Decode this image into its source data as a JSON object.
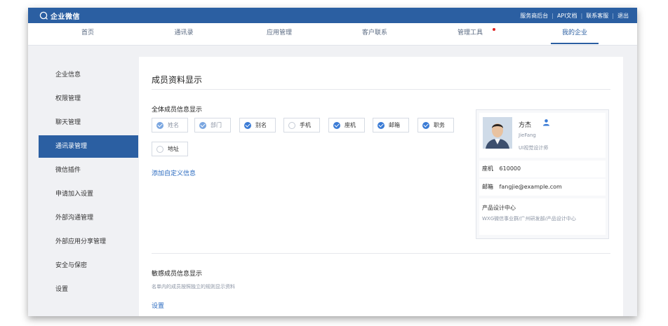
{
  "topbar": {
    "logo_text": "企业微信",
    "links": [
      "服务商后台",
      "API文档",
      "联系客服",
      "退出"
    ]
  },
  "nav": {
    "tabs": [
      {
        "label": "首页"
      },
      {
        "label": "通讯录"
      },
      {
        "label": "应用管理"
      },
      {
        "label": "客户联系"
      },
      {
        "label": "管理工具"
      },
      {
        "label": "我的企业"
      }
    ],
    "active": "我的企业",
    "badge_on": "管理工具"
  },
  "sidebar": {
    "items": [
      {
        "label": "企业信息"
      },
      {
        "label": "权限管理"
      },
      {
        "label": "聊天管理"
      },
      {
        "label": "通讯录管理"
      },
      {
        "label": "微信插件"
      },
      {
        "label": "申请加入设置"
      },
      {
        "label": "外部沟通管理"
      },
      {
        "label": "外部应用分享管理"
      },
      {
        "label": "安全与保密"
      },
      {
        "label": "设置"
      }
    ],
    "active": "通讯录管理"
  },
  "main": {
    "title": "成员资料显示",
    "all_members_label": "全体成员信息显示",
    "fields": [
      {
        "label": "姓名",
        "checked": true,
        "locked": true
      },
      {
        "label": "部门",
        "checked": true,
        "locked": true
      },
      {
        "label": "别名",
        "checked": true,
        "locked": false
      },
      {
        "label": "手机",
        "checked": false,
        "locked": false
      },
      {
        "label": "座机",
        "checked": true,
        "locked": false
      },
      {
        "label": "邮箱",
        "checked": true,
        "locked": false
      },
      {
        "label": "职务",
        "checked": true,
        "locked": false
      },
      {
        "label": "地址",
        "checked": false,
        "locked": false
      }
    ],
    "add_custom_link": "添加自定义信息",
    "sensitive_label": "敏感成员信息显示",
    "sensitive_desc": "名单内的成员按照独立的规则显示资料",
    "settings_link": "设置"
  },
  "preview_card": {
    "name": "方杰",
    "english_name": "JieFang",
    "role": "UI视觉设计师",
    "phone_key": "座机",
    "phone": "610000",
    "email_key": "邮箱",
    "email": "fangjie@example.com",
    "dept": "产品设计中心",
    "dept_path": "WXG微信事业群/广州研发部/产品设计中心"
  },
  "colors": {
    "brand": "#2b5fa2",
    "checked": "#3a7bd5",
    "link": "#2b6bc0",
    "badge": "#e02020"
  }
}
